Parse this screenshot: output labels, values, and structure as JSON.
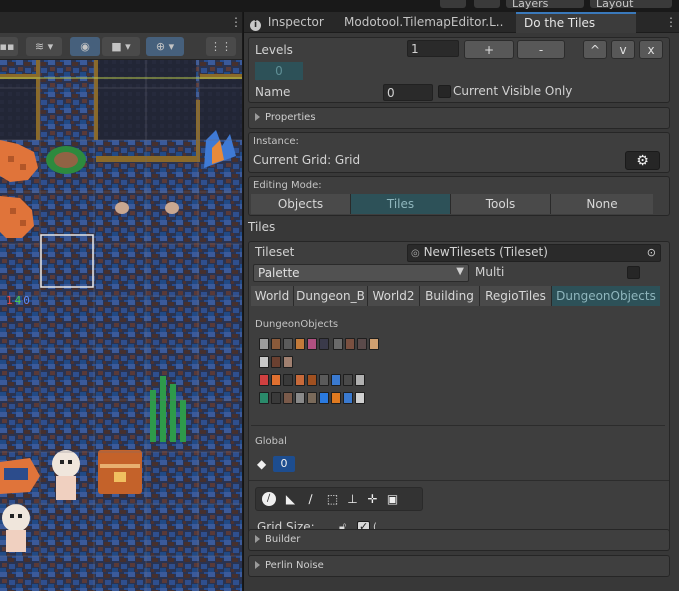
{
  "top_strip": {
    "layers_label": "Layers",
    "layout_label": "Layout"
  },
  "scene": {
    "coord_readout": [
      "1",
      "4",
      "0"
    ],
    "coord_colors": [
      "#e84c4c",
      "#4cd04c",
      "#5a8cff"
    ]
  },
  "tabs": [
    {
      "label": "Inspector",
      "icon": "info-icon",
      "active": false
    },
    {
      "label": "Modotool.TilemapEditor.L...",
      "active": false
    },
    {
      "label": "Do the Tiles",
      "active": true
    }
  ],
  "levels": {
    "label": "Levels",
    "value": "1",
    "plus_label": "+",
    "minus_label": "-",
    "up_label": "^",
    "down_label": "v",
    "close_label": "x",
    "list_value": "0"
  },
  "name_row": {
    "label": "Name",
    "value": "0",
    "current_visible_label": "Current Visible Only",
    "current_visible_checked": false
  },
  "properties_foldout": "Properties",
  "instance": {
    "label": "Instance:",
    "current_grid": "Current Grid: Grid",
    "settings_icon": "gear-icon"
  },
  "editing_mode": {
    "label": "Editing Mode:",
    "options": [
      "Objects",
      "Tiles",
      "Tools",
      "None"
    ],
    "selected": 1
  },
  "tiles": {
    "heading": "Tiles",
    "tileset_label": "Tileset",
    "tileset_value": "NewTilesets (Tileset)",
    "palette_value": "Palette",
    "multi_label": "Multi",
    "multi_checked": false,
    "tileset_tabs": [
      "World",
      "Dungeon_B",
      "World2",
      "Building",
      "RegioTiles",
      "DungeonObjects"
    ],
    "selected_tab": 5,
    "group_label": "DungeonObjects",
    "global_label": "Global",
    "eraser_value": "0",
    "tool_icons": [
      "brush-icon",
      "fill-icon",
      "line-icon",
      "rect-select-icon",
      "stamp-icon",
      "move-icon",
      "frame-icon"
    ],
    "grid_size_label": "Grid Size:",
    "grid_size_locked": false,
    "grid_size_checked": true,
    "grid_size_value": "("
  },
  "builder_foldout": "Builder",
  "perlin_foldout": "Perlin Noise",
  "colors": {
    "accent": "#3a79bb",
    "selected_tab_bg": "#2d5158",
    "selected_tab_text": "#8fb6bd",
    "panel_bg": "#3e3e3e",
    "window_bg": "#383838"
  }
}
